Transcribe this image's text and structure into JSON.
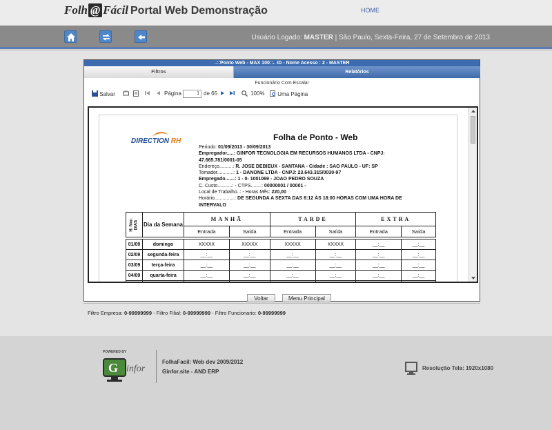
{
  "header": {
    "logo_pre": "Folh",
    "logo_at": "@",
    "logo_post": "Fácil",
    "portal_title": "Portal Web Demonstração",
    "home_link": "HOME"
  },
  "navbar": {
    "user_label": "Usuário Logado:",
    "user_name": "MASTER",
    "user_suffix": "| São Paulo, Sexta-Feira, 27 de Setembro de 2013"
  },
  "window": {
    "title": "..::Ponto Web - MAX 100::.. ID - Nome Acesso : 2 - MASTER",
    "tabs": [
      {
        "label": "Filtros"
      },
      {
        "label": "Relatórios"
      }
    ],
    "message": "Funcionário Com Escala!"
  },
  "toolbar": {
    "save_label": "Salvar",
    "page_label": "Página",
    "page_value": "1",
    "page_of": "de 65",
    "zoom_label": "100%",
    "one_page_label": "Uma Página"
  },
  "report": {
    "logo_main": "DIRECTION",
    "logo_rh": "RH",
    "title": "Folha de Ponto - Web",
    "period_label": "Periodo:",
    "period_value": "01/09/2013 - 30/09/2013",
    "employer_line1": "Empregador.....: GINFOR TECNOLOGIA EM RECURSOS HUMANOS LTDA   - CNPJ:",
    "employer_line2": "47.665.781/0001-05",
    "address_label": "Endereço..........:",
    "address_value": "R. JOSE DEBIEUX - SANTANA   - Cidade : SAO PAULO - UF:  SP",
    "tomador_label": "Tomador............:",
    "tomador_value": "1 - DANONE LTDA    - CNPJ: 23.643.315/0030-97",
    "empregado_label": "Empregado.......:",
    "empregado_value": "1 - 0- 1001069 - JOAO PEDRO SOUZA",
    "custo_label": "C. Custo...........:  -   CTPS........:",
    "custo_value": "00000001 / 00001 -",
    "local_label": "Local de Trabalho..:   - Horas Mês:",
    "local_value": "220,00",
    "horario_label": "Horário...............:",
    "horario_value": "DE SEGUNDA A SEXTA DAS 8:12 ÀS 18:00 HORAS COM UMA HORA DE INTERVALO",
    "col_nor": "H. Nor.",
    "col_dias": "DIAS",
    "col_dia_semana": "Dia da Semana",
    "grp_manha": "MANHÃ",
    "grp_tarde": "TARDE",
    "grp_extra": "EXTRA",
    "entrada": "Entrada",
    "saida": "Saída",
    "rows": [
      {
        "date": "01/09",
        "day": "domingo",
        "c": [
          "XXXXX",
          "XXXXX",
          "XXXXX",
          "XXXXX",
          "__:__",
          "__:__"
        ]
      },
      {
        "date": "02/09",
        "day": "segunda-feira",
        "c": [
          "__:__",
          "__:__",
          "__:__",
          "__:__",
          "__:__",
          "__:__"
        ]
      },
      {
        "date": "03/09",
        "day": "terça-feira",
        "c": [
          "__:__",
          "__:__",
          "__:__",
          "__:__",
          "__:__",
          "__:__"
        ]
      },
      {
        "date": "04/09",
        "day": "quarta-feira",
        "c": [
          "__:__",
          "__:__",
          "__:__",
          "__:__",
          "__:__",
          "__:__"
        ]
      }
    ]
  },
  "buttons": {
    "voltar": "Voltar",
    "menu_principal": "Menu Principal"
  },
  "filters": {
    "empresa_label": "Filtro Empresa:",
    "empresa_value": "0-99999999",
    "filial_label": "- Filtro Filial:",
    "filial_value": "0-99999999",
    "func_label": "- Filtro Funcionario:",
    "func_value": "0-99999999"
  },
  "footer": {
    "powered": "POWERED BY",
    "brand": "infor",
    "info1": "FolhaFacil: Web dev 2009/2012",
    "info2": "Ginfor.site - AND ERP",
    "resolution": "Resolução Tela: 1920x1080"
  },
  "colors": {
    "accent": "#3d6bb0",
    "nav_gray": "#8a8a8a",
    "nav_button": "#4e86c7"
  }
}
